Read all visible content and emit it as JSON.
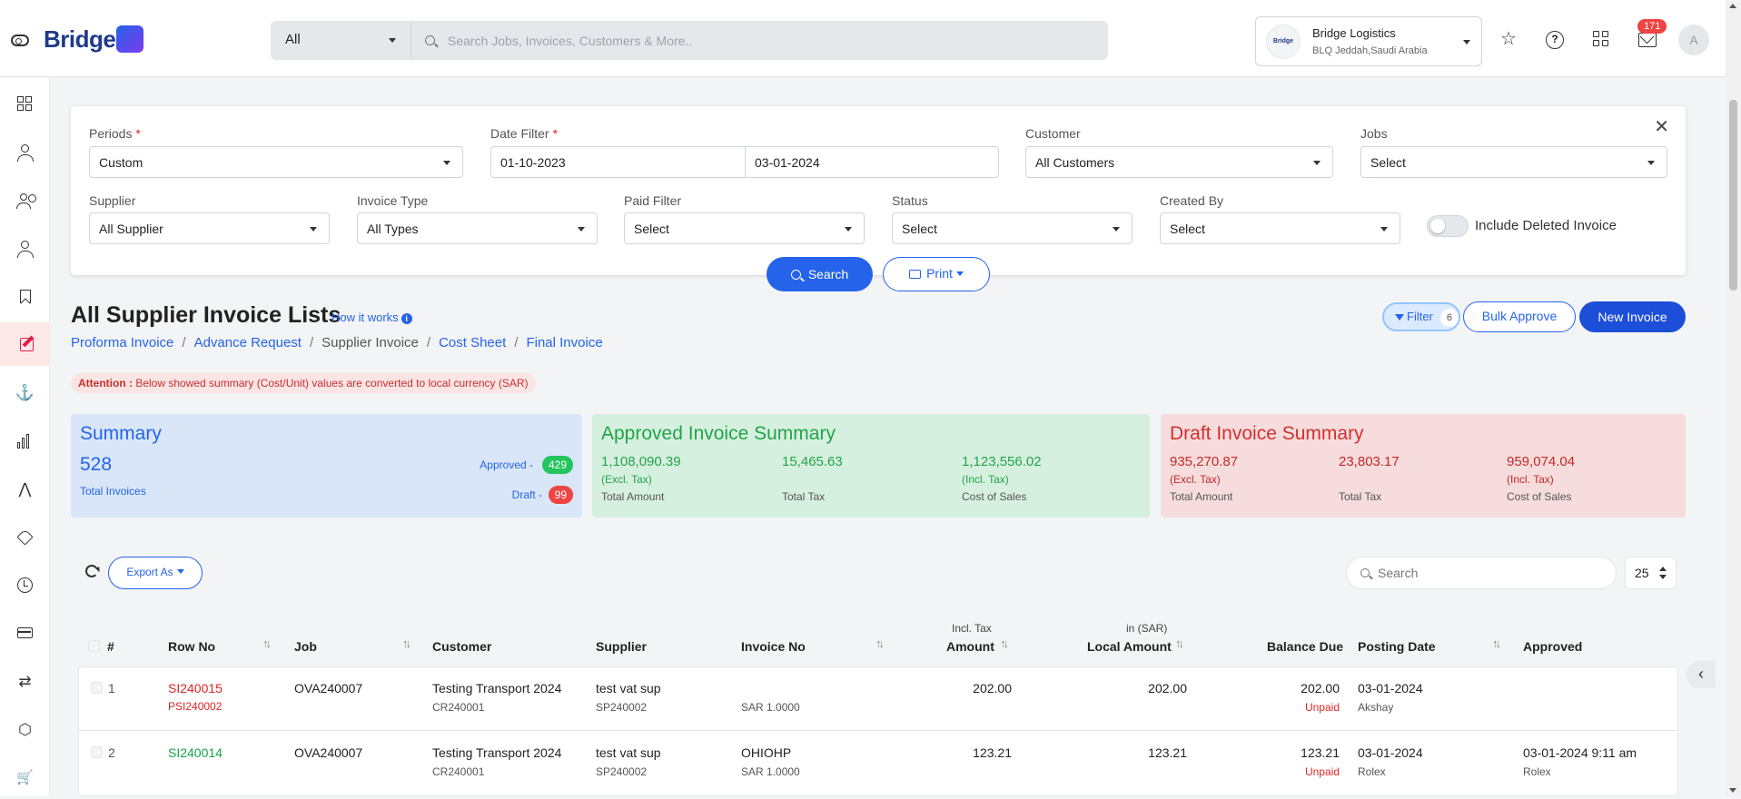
{
  "app": {
    "logo_text": "Bridge"
  },
  "top_search": {
    "type_label": "All",
    "placeholder": "Search Jobs, Invoices, Customers & More.."
  },
  "company": {
    "logo_text": "Bridge",
    "name": "Bridge Logistics",
    "location": "BLQ Jeddah,Saudi Arabia"
  },
  "notifications": {
    "count": "171"
  },
  "user": {
    "initial": "A"
  },
  "sidebar": {
    "items": [
      {
        "icon": "dashboard-icon"
      },
      {
        "icon": "user-icon"
      },
      {
        "icon": "users-icon"
      },
      {
        "icon": "add-user-icon"
      },
      {
        "icon": "bookmark-icon"
      },
      {
        "icon": "edit-icon",
        "active": true
      },
      {
        "icon": "anchor-icon",
        "glyph": "⚓"
      },
      {
        "icon": "bar-chart-icon"
      },
      {
        "icon": "navigation-icon",
        "glyph": "⋀"
      },
      {
        "icon": "tag-icon"
      },
      {
        "icon": "clock-icon"
      },
      {
        "icon": "card-icon"
      },
      {
        "icon": "repeat-icon",
        "glyph": "⇄"
      },
      {
        "icon": "box-icon",
        "glyph": "⬡"
      },
      {
        "icon": "cart-icon",
        "glyph": "🛒"
      }
    ]
  },
  "filters": {
    "periods": {
      "label": "Periods",
      "value": "Custom"
    },
    "date_filter": {
      "label": "Date Filter",
      "from": "01-10-2023",
      "to": "03-01-2024"
    },
    "customer": {
      "label": "Customer",
      "value": "All Customers"
    },
    "jobs": {
      "label": "Jobs",
      "value": "Select"
    },
    "supplier": {
      "label": "Supplier",
      "value": "All Supplier"
    },
    "invoice_type": {
      "label": "Invoice Type",
      "value": "All Types"
    },
    "paid_filter": {
      "label": "Paid Filter",
      "value": "Select"
    },
    "status": {
      "label": "Status",
      "value": "Select"
    },
    "created_by": {
      "label": "Created By",
      "value": "Select"
    },
    "include_deleted": {
      "label": "Include Deleted Invoice",
      "on": false
    },
    "required_mark": "*",
    "close_glyph": "✕",
    "search_label": "Search",
    "print_label": "Print"
  },
  "page": {
    "title": "All Supplier Invoice Lists",
    "how_it_works": "How it works",
    "breadcrumbs": [
      "Proforma Invoice",
      "Advance Request",
      "Supplier Invoice",
      "Cost Sheet",
      "Final Invoice"
    ],
    "breadcrumb_sep": "/",
    "attention_label": "Attention :",
    "attention_text": "Below showed summary (Cost/Unit) values are converted to local currency (SAR)",
    "filter_label": "Filter",
    "filter_count": "6",
    "bulk_approve": "Bulk Approve",
    "new_invoice": "New Invoice"
  },
  "summary": {
    "title": "Summary",
    "total": "528",
    "total_label": "Total Invoices",
    "approved_label": "Approved -",
    "approved_count": "429",
    "draft_label": "Draft -",
    "draft_count": "99"
  },
  "approved_summary": {
    "title": "Approved Invoice Summary",
    "total_amount": "1,108,090.39",
    "total_amount_sub": "(Excl. Tax)",
    "total_amount_label": "Total Amount",
    "total_tax": "15,465.63",
    "total_tax_label": "Total Tax",
    "cost_of_sales": "1,123,556.02",
    "cost_of_sales_sub": "(Incl. Tax)",
    "cost_of_sales_label": "Cost of Sales"
  },
  "draft_summary": {
    "title": "Draft Invoice Summary",
    "total_amount": "935,270.87",
    "total_amount_sub": "(Excl. Tax)",
    "total_amount_label": "Total Amount",
    "total_tax": "23,803.17",
    "total_tax_label": "Total Tax",
    "cost_of_sales": "959,074.04",
    "cost_of_sales_sub": "(Incl. Tax)",
    "cost_of_sales_label": "Cost of Sales"
  },
  "table": {
    "export_label": "Export As",
    "search_placeholder": "Search",
    "page_size": "25",
    "headers": {
      "num": "#",
      "row_no": "Row No",
      "job": "Job",
      "customer": "Customer",
      "supplier": "Supplier",
      "invoice_no": "Invoice No",
      "amount_sub": "Incl. Tax",
      "amount": "Amount",
      "local_amount_sub": "in (SAR)",
      "local_amount": "Local Amount",
      "balance_due": "Balance Due",
      "posting_date": "Posting Date",
      "approved": "Approved"
    },
    "rows": [
      {
        "num": "1",
        "row_no": "SI240015",
        "row_no_sub": "PSI240002",
        "row_color": "#dc2626",
        "job": "OVA240007",
        "customer": "Testing Transport 2024",
        "customer_sub": "CR240001",
        "supplier": "test vat sup",
        "supplier_sub": "SP240002",
        "invoice_no": "",
        "invoice_sub": "SAR 1.0000",
        "amount": "202.00",
        "local_amount": "202.00",
        "balance_due": "202.00",
        "balance_status": "Unpaid",
        "posting_date": "03-01-2024",
        "posted_by": "Akshay",
        "approved": "",
        "approved_by": ""
      },
      {
        "num": "2",
        "row_no": "SI240014",
        "row_no_sub": "",
        "row_color": "#16a34a",
        "job": "OVA240007",
        "customer": "Testing Transport 2024",
        "customer_sub": "CR240001",
        "supplier": "test vat sup",
        "supplier_sub": "SP240002",
        "invoice_no": "OHIOHP",
        "invoice_sub": "SAR 1.0000",
        "amount": "123.21",
        "local_amount": "123.21",
        "balance_due": "123.21",
        "balance_status": "Unpaid",
        "posting_date": "03-01-2024",
        "posted_by": "Rolex",
        "approved": "03-01-2024 9:11 am",
        "approved_by": "Rolex"
      }
    ]
  },
  "collapse_glyph": "‹"
}
